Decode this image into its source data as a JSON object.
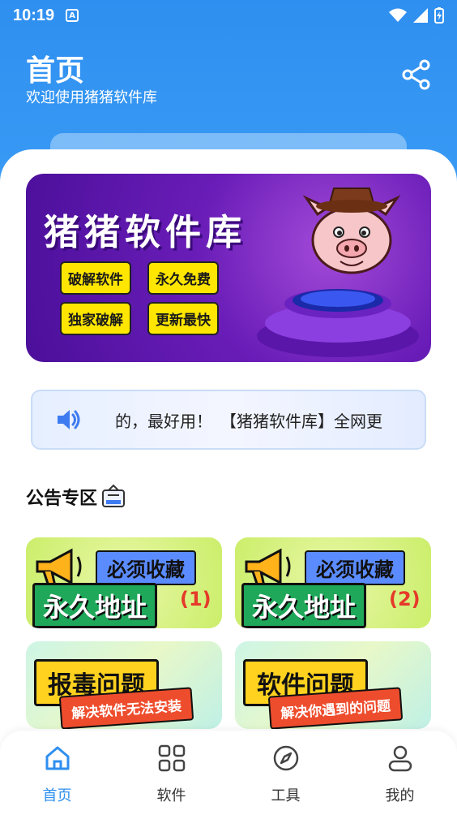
{
  "status": {
    "time": "10:19",
    "a_icon": "A"
  },
  "header": {
    "title": "首页",
    "subtitle": "欢迎使用猪猪软件库"
  },
  "banner": {
    "title": "猪猪软件库",
    "tags": [
      "破解软件",
      "永久免费",
      "独家破解",
      "更新最快"
    ]
  },
  "notice": {
    "text": "的，最好用！　【猪猪软件库】全网更"
  },
  "announcements": {
    "title": "公告专区",
    "cards": [
      {
        "top": "必须收藏",
        "main": "永久地址",
        "num": "(1)"
      },
      {
        "top": "必须收藏",
        "main": "永久地址",
        "num": "(2)"
      },
      {
        "title": "报毒问题",
        "sub": "解决软件无法安装"
      },
      {
        "title": "软件问题",
        "sub": "解决你遇到的问题"
      }
    ]
  },
  "tabs": [
    {
      "label": "首页",
      "icon": "home-icon"
    },
    {
      "label": "软件",
      "icon": "grid-icon"
    },
    {
      "label": "工具",
      "icon": "compass-icon"
    },
    {
      "label": "我的",
      "icon": "user-icon"
    }
  ],
  "colors": {
    "primary": "#2f8ff0",
    "banner": "#6a1db8"
  }
}
